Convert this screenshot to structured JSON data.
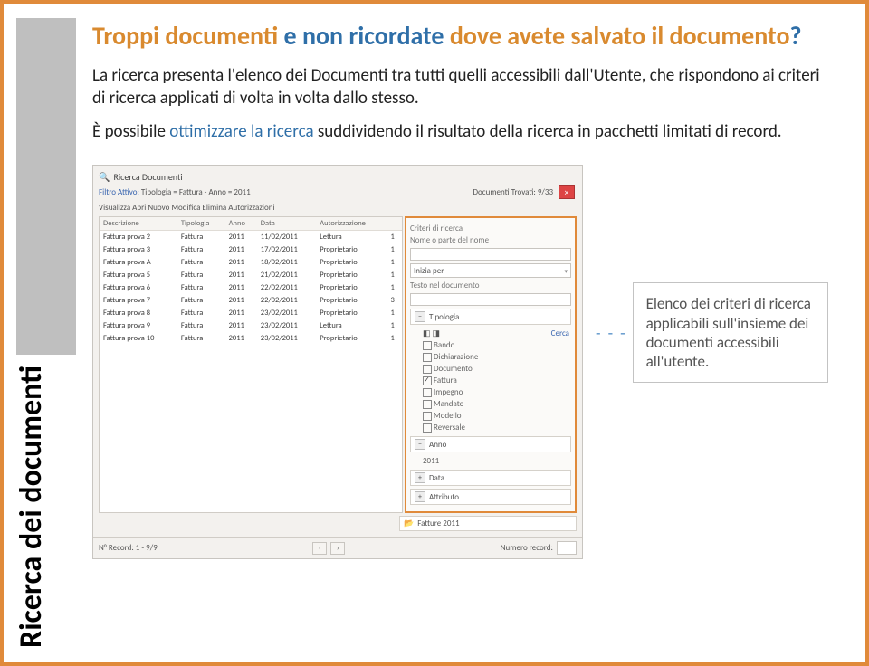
{
  "rail_label": "Ricerca dei documenti",
  "heading": {
    "a": "Troppi documenti",
    "b": " e non ricordate ",
    "c": "dove avete salvato il documento",
    "q": "?"
  },
  "para1": "La ricerca presenta l'elenco dei Documenti tra tutti quelli accessibili dall'Utente, che rispondono ai criteri di ricerca applicati di volta in volta dallo stesso.",
  "para2_a": "È possibile ",
  "para2_link": "ottimizzare la ricerca",
  "para2_b": " suddividendo il risultato della ricerca in pacchetti limitati di record.",
  "screenshot": {
    "title": "Ricerca Documenti",
    "filter_label": "Filtro Attivo:",
    "filter_value": "Tipologia = Fattura - Anno = 2011",
    "found_label": "Documenti Trovati: 9/33",
    "toolbar": "Visualizza  Apri  Nuovo  Modifica  Elimina  Autorizzazioni",
    "cols": [
      "Descrizione",
      "Tipologia",
      "Anno",
      "Data",
      "Autorizzazione"
    ],
    "rows": [
      [
        "Fattura prova 2",
        "Fattura",
        "2011",
        "11/02/2011",
        "Lettura",
        "1"
      ],
      [
        "Fattura prova 3",
        "Fattura",
        "2011",
        "17/02/2011",
        "Proprietario",
        "1"
      ],
      [
        "Fattura prova A",
        "Fattura",
        "2011",
        "18/02/2011",
        "Proprietario",
        "1"
      ],
      [
        "Fattura prova 5",
        "Fattura",
        "2011",
        "21/02/2011",
        "Proprietario",
        "1"
      ],
      [
        "Fattura prova 6",
        "Fattura",
        "2011",
        "22/02/2011",
        "Proprietario",
        "1"
      ],
      [
        "Fattura prova 7",
        "Fattura",
        "2011",
        "22/02/2011",
        "Proprietario",
        "3"
      ],
      [
        "Fattura prova 8",
        "Fattura",
        "2011",
        "23/02/2011",
        "Proprietario",
        "1"
      ],
      [
        "Fattura prova 9",
        "Fattura",
        "2011",
        "23/02/2011",
        "Lettura",
        "1"
      ],
      [
        "Fattura prova 10",
        "Fattura",
        "2011",
        "23/02/2011",
        "Proprietario",
        "1"
      ]
    ],
    "side": {
      "criteri": "Criteri di ricerca",
      "nome": "Nome o parte del nome",
      "inizia": "Inizia per",
      "testo": "Testo nel documento",
      "tipologia": "Tipologia",
      "cerca": "Cerca",
      "cats": [
        {
          "label": "Bando",
          "checked": false
        },
        {
          "label": "Dichiarazione",
          "checked": false
        },
        {
          "label": "Documento",
          "checked": false
        },
        {
          "label": "Fattura",
          "checked": true
        },
        {
          "label": "Impegno",
          "checked": false
        },
        {
          "label": "Mandato",
          "checked": false
        },
        {
          "label": "Modello",
          "checked": false
        },
        {
          "label": "Reversale",
          "checked": false
        }
      ],
      "anno": "Anno",
      "anno_val": "2011",
      "data": "Data",
      "attributo": "Attributo",
      "recenti": "Fatture 2011"
    },
    "bottom": {
      "record_label": "N° Record: 1 - 9/9",
      "numrec_label": "Numero record:"
    }
  },
  "callout": "Elenco dei criteri di ricerca applicabili sull'insieme dei documenti accessibili all'utente."
}
